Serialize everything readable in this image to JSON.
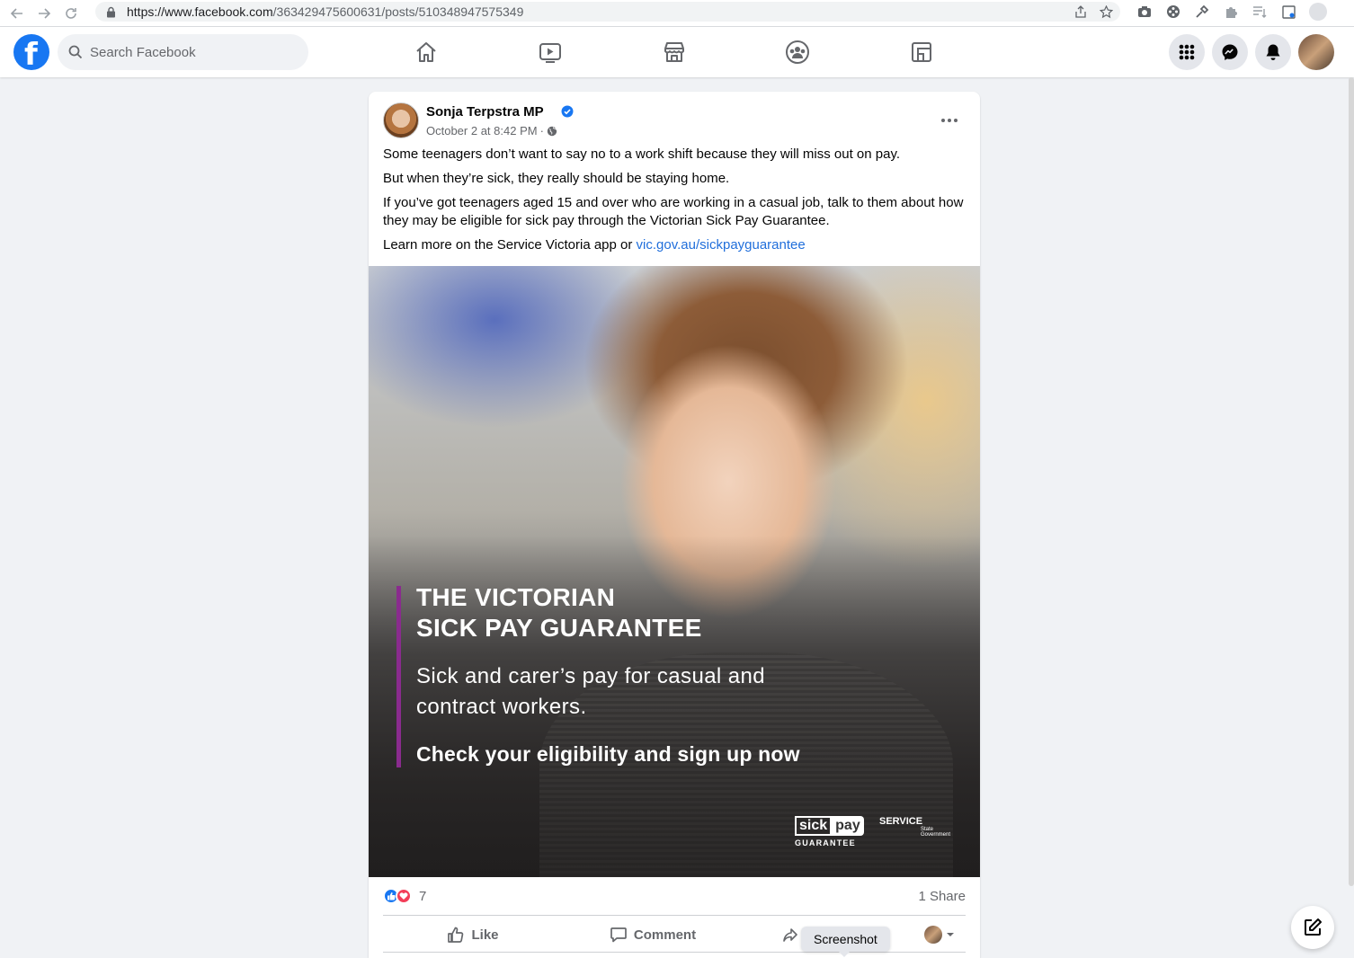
{
  "browser": {
    "url_host": "https://www.facebook.com",
    "url_path": "/363429475600631/posts/510348947575349"
  },
  "fb": {
    "search_placeholder": "Search Facebook",
    "nav_icons": [
      "home-icon",
      "watch-icon",
      "marketplace-icon",
      "groups-icon",
      "gaming-icon"
    ],
    "right_icons": [
      "menu-grid-icon",
      "messenger-icon",
      "notifications-icon",
      "profile-avatar"
    ]
  },
  "post": {
    "author": "Sonja Terpstra MP",
    "timestamp": "October 2 at 8:42 PM",
    "meta_separator": "·",
    "paragraphs": [
      "Some teenagers don’t want to say no to a work shift because they will miss out on pay.",
      "But when they’re sick, they really should be staying home.",
      "If you’ve got teenagers aged 15 and over who are working in a casual job, talk to them about how they may be eligible for sick pay through the Victorian Sick Pay Guarantee."
    ],
    "last_line_prefix": "Learn more on the Service Victoria app or ",
    "link_text": "vic.gov.au/sickpayguarantee",
    "image": {
      "title_line1": "THE VICTORIAN",
      "title_line2": "SICK PAY GUARANTEE",
      "subtitle_line1": "Sick and carer’s pay for casual and",
      "subtitle_line2": "contract workers.",
      "cta": "Check your eligibility and sign up now",
      "logo_sick": "sick",
      "logo_pay": "pay",
      "logo_guarantee": "GUARANTEE",
      "logo_service": "SERVICE",
      "logo_service_sub1": "State",
      "logo_service_sub2": "Government"
    },
    "reaction_count": "7",
    "share_count": "1 Share",
    "actions": {
      "like": "Like",
      "comment": "Comment"
    }
  },
  "tooltip": "Screenshot"
}
